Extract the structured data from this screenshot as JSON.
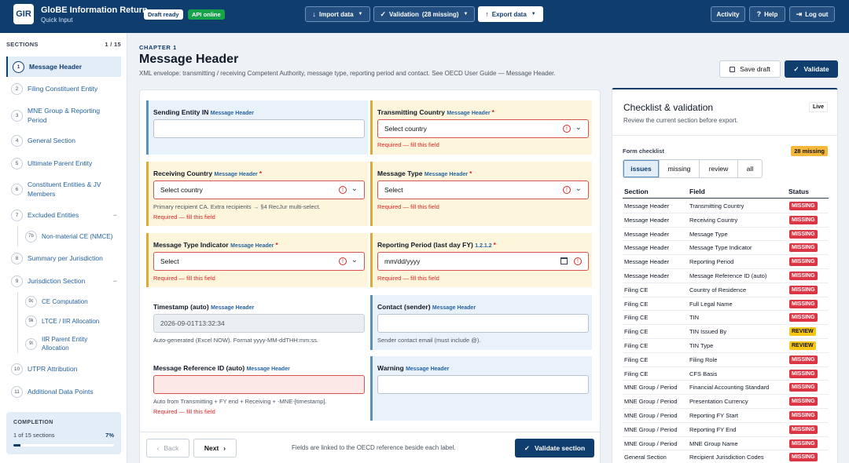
{
  "app": {
    "logo": "GIR",
    "title": "GloBE Information Return",
    "subtitle": "Quick Input",
    "draft_badge": "Draft ready",
    "api_badge": "API online"
  },
  "toolbar": {
    "import": "Import data",
    "validation": "Validation",
    "validation_count": "(28 missing)",
    "export": "Export data",
    "activity": "Activity",
    "help": "Help",
    "logout": "Log out"
  },
  "sidebar": {
    "heading": "SECTIONS",
    "count": "1 / 15",
    "items": [
      {
        "num": "1",
        "label": "Message Header"
      },
      {
        "num": "2",
        "label": "Filing Constituent Entity"
      },
      {
        "num": "3",
        "label": "MNE Group & Reporting Period"
      },
      {
        "num": "4",
        "label": "General Section"
      },
      {
        "num": "5",
        "label": "Ultimate Parent Entity"
      },
      {
        "num": "6",
        "label": "Constituent Entities & JV Members"
      },
      {
        "num": "7",
        "label": "Excluded Entities"
      },
      {
        "num": "8",
        "label": "Summary per Jurisdiction"
      },
      {
        "num": "9",
        "label": "Jurisdiction Section"
      },
      {
        "num": "10",
        "label": "UTPR Attribution"
      },
      {
        "num": "11",
        "label": "Additional Data Points"
      }
    ],
    "sub7": [
      {
        "num": "7b",
        "label": "Non-material CE (NMCE)"
      }
    ],
    "sub9": [
      {
        "num": "9c",
        "label": "CE Computation"
      },
      {
        "num": "9k",
        "label": "LTCE / IIR Allocation"
      },
      {
        "num": "9l",
        "label": "IIR Parent Entity Allocation"
      }
    ],
    "collapse_symbol": "−"
  },
  "completion": {
    "title": "COMPLETION",
    "sections": "1 of 15 sections",
    "percent_label": "7%",
    "progress": 0.07
  },
  "page": {
    "chapter": "CHAPTER 1",
    "title": "Message Header",
    "description": "XML envelope: transmitting / receiving Competent Authority, message type, reporting period and contact. See OECD User Guide — Message Header.",
    "save_draft": "Save draft",
    "validate": "Validate"
  },
  "ref_tag": "Message Header",
  "required_error": "Required — fill this field",
  "fields": {
    "sending_in": {
      "label": "Sending Entity IN",
      "value": ""
    },
    "transmitting": {
      "label": "Transmitting Country",
      "value": "Select country"
    },
    "receiving": {
      "label": "Receiving Country",
      "value": "Select country",
      "hint": "Primary recipient CA. Extra recipients → §4 RecJur multi-select."
    },
    "msg_type": {
      "label": "Message Type",
      "value": "Select"
    },
    "msg_type_ind": {
      "label": "Message Type Indicator",
      "value": "Select"
    },
    "period": {
      "label": "Reporting Period (last day FY)",
      "ref": "1.2.1.2",
      "value": "mm/dd/yyyy"
    },
    "timestamp": {
      "label": "Timestamp (auto)",
      "value": "2026-09-01T13:32:34",
      "hint": "Auto-generated (Excel NOW). Format yyyy-MM-ddTHH:mm:ss."
    },
    "contact": {
      "label": "Contact (sender)",
      "value": "",
      "hint": "Sender contact email (must include @)."
    },
    "msg_ref": {
      "label": "Message Reference ID (auto)",
      "value": "",
      "hint": "Auto from Transmitting + FY end + Receiving + -MNE-[timestamp]."
    },
    "warning": {
      "label": "Warning",
      "value": ""
    }
  },
  "footer": {
    "back": "Back",
    "next": "Next",
    "note": "Fields are linked to the OECD reference beside each label.",
    "validate_section": "Validate section"
  },
  "panel": {
    "title": "Checklist & validation",
    "subtitle": "Review the current section before export.",
    "live": "Live",
    "form_checklist": "Form checklist",
    "missing_count": "28 missing",
    "tabs": [
      "issues",
      "missing",
      "review",
      "all"
    ],
    "columns": [
      "Section",
      "Field",
      "Status"
    ],
    "rows": [
      [
        "Message Header",
        "Transmitting Country",
        "MISSING"
      ],
      [
        "Message Header",
        "Receiving Country",
        "MISSING"
      ],
      [
        "Message Header",
        "Message Type",
        "MISSING"
      ],
      [
        "Message Header",
        "Message Type Indicator",
        "MISSING"
      ],
      [
        "Message Header",
        "Reporting Period",
        "MISSING"
      ],
      [
        "Message Header",
        "Message Reference ID (auto)",
        "MISSING"
      ],
      [
        "Filing CE",
        "Country of Residence",
        "MISSING"
      ],
      [
        "Filing CE",
        "Full Legal Name",
        "MISSING"
      ],
      [
        "Filing CE",
        "TIN",
        "MISSING"
      ],
      [
        "Filing CE",
        "TIN Issued By",
        "REVIEW"
      ],
      [
        "Filing CE",
        "TIN Type",
        "REVIEW"
      ],
      [
        "Filing CE",
        "Filing Role",
        "MISSING"
      ],
      [
        "Filing CE",
        "CFS Basis",
        "MISSING"
      ],
      [
        "MNE Group / Period",
        "Financial Accounting Standard",
        "MISSING"
      ],
      [
        "MNE Group / Period",
        "Presentation Currency",
        "MISSING"
      ],
      [
        "MNE Group / Period",
        "Reporting FY Start",
        "MISSING"
      ],
      [
        "MNE Group / Period",
        "Reporting FY End",
        "MISSING"
      ],
      [
        "MNE Group / Period",
        "MNE Group Name",
        "MISSING"
      ],
      [
        "General Section",
        "Recipient Jurisdiction Codes",
        "MISSING"
      ]
    ]
  },
  "colors": {
    "brand": "#0f3d6e",
    "missing": "#dc3545",
    "review": "#f5c518",
    "required_border": "#e0a838"
  }
}
